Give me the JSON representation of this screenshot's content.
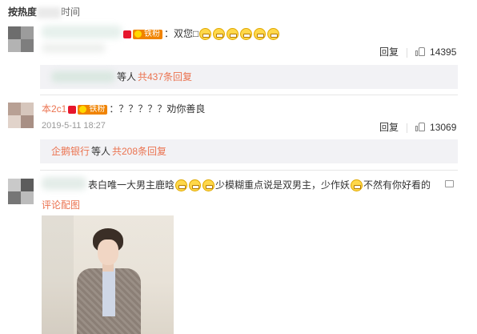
{
  "sort": {
    "hot": "按热度",
    "time": "时间"
  },
  "comments": [
    {
      "badge": "铁粉",
      "text": "：双您",
      "glyph": "□",
      "emoji_count": 6,
      "reply": "回复",
      "likes": "14395",
      "reply_box": {
        "suffix": "等人",
        "count_text": "共437条回复"
      }
    },
    {
      "name": "本2c1",
      "badge": "铁粉",
      "text": "：？？？？？劝你善良",
      "time": "2019-5-11 18:27",
      "reply": "回复",
      "likes": "13069",
      "reply_box": {
        "name": "企鹅银行",
        "suffix": "等人",
        "count_text": "共208条回复"
      }
    },
    {
      "text_a": "表白唯一大男主鹿晗",
      "text_b": "少模糊重点说是双男主，少作妖",
      "text_c": "不然有你好看的",
      "pic_link": "评论配图"
    }
  ]
}
